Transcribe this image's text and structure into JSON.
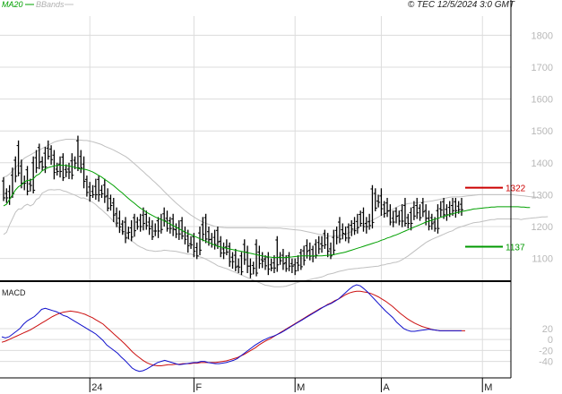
{
  "header": {
    "legend_ma": "MA20",
    "legend_bbands": "BBands",
    "source": "© TEC 12/5/2024 3:0 GMT"
  },
  "colors": {
    "price": "#000000",
    "ma20": "#00a000",
    "bbands": "#c0c0c0",
    "resistance": "#cc0000",
    "support": "#009900",
    "macd": "#1010cc",
    "signal": "#cc1010",
    "grid": "#dcdcdc",
    "axis_text": "#b8b8b8"
  },
  "chart_data": [
    {
      "type": "line",
      "panel": "price",
      "y_ticks": [
        "1800",
        "1700",
        "1600",
        "1500",
        "1400",
        "1300",
        "1200",
        "1100"
      ],
      "y_tick_values": [
        1800,
        1700,
        1600,
        1500,
        1400,
        1300,
        1200,
        1100
      ],
      "ylim": [
        1040,
        1860
      ],
      "x_tick_labels": [
        "24",
        "F",
        "M",
        "A",
        "M"
      ],
      "x_tick_index": [
        29,
        64,
        98,
        127,
        161
      ],
      "levels": [
        {
          "label": "1322",
          "value": 1322,
          "color": "#cc0000"
        },
        {
          "label": "1137",
          "value": 1137,
          "color": "#009900"
        }
      ],
      "series": [
        {
          "name": "MA20",
          "values": [
            1265,
            1270,
            1285,
            1300,
            1315,
            1325,
            1330,
            1340,
            1345,
            1345,
            1350,
            1360,
            1365,
            1375,
            1380,
            1385,
            1388,
            1390,
            1392,
            1393,
            1392,
            1392,
            1390,
            1388,
            1386,
            1383,
            1380,
            1380,
            1378,
            1375,
            1371,
            1366,
            1360,
            1355,
            1348,
            1342,
            1335,
            1328,
            1320,
            1312,
            1305,
            1296,
            1288,
            1280,
            1273,
            1265,
            1258,
            1252,
            1245,
            1240,
            1235,
            1230,
            1226,
            1222,
            1218,
            1213,
            1208,
            1203,
            1198,
            1193,
            1188,
            1183,
            1178,
            1175,
            1170,
            1166,
            1162,
            1158,
            1154,
            1150,
            1146,
            1142,
            1138,
            1136,
            1134,
            1132,
            1130,
            1128,
            1126,
            1124,
            1122,
            1120,
            1118,
            1116,
            1114,
            1112,
            1110,
            1108,
            1106,
            1105,
            1104,
            1103,
            1103,
            1103,
            1103,
            1103,
            1104,
            1105,
            1106,
            1107,
            1108,
            1108,
            1108,
            1108,
            1108,
            1108,
            1108,
            1108,
            1109,
            1110,
            1111,
            1112,
            1114,
            1116,
            1118,
            1120,
            1123,
            1126,
            1129,
            1132,
            1135,
            1138,
            1141,
            1144,
            1147,
            1150,
            1153,
            1157,
            1160,
            1164,
            1167,
            1171,
            1174,
            1178,
            1182,
            1186,
            1190,
            1194,
            1198,
            1202,
            1206,
            1210,
            1214,
            1217,
            1220,
            1223,
            1226,
            1229,
            1232,
            1235,
            1238,
            1240,
            1243,
            1245,
            1247,
            1249,
            1251,
            1253,
            1255,
            1256,
            1257,
            1258,
            1259,
            1260,
            1261,
            1261,
            1262,
            1262,
            1262,
            1262,
            1262,
            1262,
            1262,
            1262,
            1261,
            1261,
            1260,
            1260
          ]
        },
        {
          "name": "BBands upper",
          "values": [
            1355,
            1358,
            1365,
            1375,
            1385,
            1395,
            1405,
            1415,
            1420,
            1425,
            1430,
            1435,
            1440,
            1445,
            1450,
            1455,
            1460,
            1465,
            1468,
            1470,
            1472,
            1474,
            1474,
            1474,
            1473,
            1472,
            1471,
            1470,
            1470,
            1468,
            1466,
            1463,
            1460,
            1457,
            1452,
            1448,
            1444,
            1440,
            1435,
            1430,
            1425,
            1420,
            1413,
            1405,
            1397,
            1389,
            1380,
            1372,
            1363,
            1355,
            1346,
            1338,
            1329,
            1320,
            1310,
            1301,
            1292,
            1283,
            1274,
            1266,
            1258,
            1250,
            1243,
            1236,
            1230,
            1224,
            1219,
            1214,
            1210,
            1207,
            1204,
            1201,
            1199,
            1198,
            1197,
            1196,
            1196,
            1196,
            1196,
            1196,
            1196,
            1196,
            1196,
            1196,
            1196,
            1196,
            1196,
            1196,
            1196,
            1195,
            1195,
            1195,
            1195,
            1195,
            1194,
            1193,
            1192,
            1191,
            1190,
            1189,
            1188,
            1186,
            1184,
            1182,
            1180,
            1178,
            1176,
            1174,
            1172,
            1170,
            1170,
            1170,
            1171,
            1172,
            1174,
            1176,
            1180,
            1185,
            1190,
            1195,
            1200,
            1205,
            1210,
            1215,
            1220,
            1225,
            1230,
            1235,
            1240,
            1245,
            1250,
            1255,
            1260,
            1265,
            1268,
            1270,
            1272,
            1273,
            1274,
            1275,
            1276,
            1277,
            1278,
            1279,
            1280,
            1282,
            1284,
            1286,
            1288,
            1290,
            1292,
            1293,
            1293,
            1293,
            1294,
            1295,
            1296,
            1297,
            1298,
            1299,
            1300,
            1300,
            1300,
            1300,
            1300,
            1300,
            1300,
            1300,
            1300,
            1300,
            1300,
            1300,
            1299,
            1298,
            1297,
            1296,
            1295,
            1294,
            1293,
            1292,
            1290,
            1289
          ]
        },
        {
          "name": "BBands lower",
          "values": [
            1175,
            1182,
            1205,
            1225,
            1245,
            1255,
            1255,
            1265,
            1270,
            1265,
            1270,
            1285,
            1290,
            1305,
            1310,
            1315,
            1316,
            1315,
            1316,
            1316,
            1312,
            1310,
            1306,
            1302,
            1299,
            1294,
            1289,
            1290,
            1286,
            1282,
            1276,
            1269,
            1260,
            1253,
            1244,
            1236,
            1226,
            1216,
            1205,
            1194,
            1185,
            1172,
            1163,
            1155,
            1149,
            1141,
            1136,
            1132,
            1127,
            1125,
            1124,
            1122,
            1123,
            1124,
            1126,
            1125,
            1124,
            1123,
            1122,
            1120,
            1118,
            1116,
            1113,
            1114,
            1110,
            1108,
            1105,
            1102,
            1098,
            1093,
            1088,
            1083,
            1077,
            1074,
            1071,
            1068,
            1064,
            1060,
            1056,
            1052,
            1048,
            1044,
            1040,
            1036,
            1032,
            1028,
            1024,
            1020,
            1016,
            1015,
            1013,
            1011,
            1011,
            1011,
            1012,
            1013,
            1016,
            1019,
            1022,
            1025,
            1028,
            1030,
            1032,
            1034,
            1036,
            1038,
            1040,
            1042,
            1046,
            1050,
            1052,
            1054,
            1057,
            1060,
            1062,
            1064,
            1066,
            1067,
            1068,
            1069,
            1070,
            1071,
            1072,
            1073,
            1074,
            1075,
            1076,
            1079,
            1080,
            1083,
            1084,
            1087,
            1088,
            1091,
            1096,
            1102,
            1108,
            1115,
            1122,
            1129,
            1136,
            1143,
            1150,
            1155,
            1160,
            1164,
            1168,
            1172,
            1176,
            1180,
            1184,
            1187,
            1193,
            1197,
            1200,
            1203,
            1206,
            1209,
            1212,
            1213,
            1214,
            1216,
            1218,
            1220,
            1222,
            1222,
            1224,
            1224,
            1224,
            1224,
            1224,
            1224,
            1224,
            1224,
            1222,
            1224,
            1225,
            1226,
            1227,
            1228,
            1229,
            1230,
            1230,
            1231
          ]
        }
      ],
      "ohlc": {
        "high": [
          1355,
          1320,
          1330,
          1385,
          1420,
          1470,
          1410,
          1360,
          1390,
          1350,
          1420,
          1440,
          1460,
          1420,
          1450,
          1470,
          1455,
          1440,
          1400,
          1420,
          1430,
          1395,
          1400,
          1430,
          1420,
          1485,
          1440,
          1420,
          1360,
          1340,
          1330,
          1350,
          1360,
          1330,
          1350,
          1320,
          1300,
          1290,
          1260,
          1250,
          1220,
          1230,
          1200,
          1220,
          1240,
          1230,
          1240,
          1260,
          1250,
          1230,
          1220,
          1210,
          1230,
          1240,
          1260,
          1250,
          1230,
          1240,
          1210,
          1220,
          1230,
          1200,
          1190,
          1170,
          1180,
          1150,
          1200,
          1230,
          1240,
          1200,
          1180,
          1190,
          1200,
          1170,
          1150,
          1160,
          1150,
          1120,
          1130,
          1100,
          1120,
          1160,
          1140,
          1100,
          1090,
          1160,
          1140,
          1120,
          1110,
          1120,
          1100,
          1110,
          1170,
          1120,
          1130,
          1110,
          1120,
          1100,
          1100,
          1110,
          1130,
          1140,
          1160,
          1150,
          1140,
          1160,
          1170,
          1170,
          1190,
          1180,
          1150,
          1190,
          1200,
          1230,
          1210,
          1200,
          1210,
          1220,
          1230,
          1240,
          1250,
          1260,
          1230,
          1240,
          1330,
          1320,
          1300,
          1320,
          1280,
          1290,
          1270,
          1250,
          1260,
          1250,
          1270,
          1290,
          1240,
          1260,
          1280,
          1290,
          1270,
          1290,
          1270,
          1250,
          1240,
          1230,
          1270,
          1280,
          1290,
          1270,
          1280,
          1290,
          1290,
          1280,
          1290
        ]
      }
    },
    {
      "type": "line",
      "panel": "macd",
      "title": "MACD",
      "y_ticks": [
        "20",
        "0",
        "-20",
        "-40"
      ],
      "y_tick_values": [
        20,
        0,
        -20,
        -40
      ],
      "ylim": [
        -70,
        100
      ],
      "series": [
        {
          "name": "MACD",
          "values": [
            5,
            3,
            5,
            10,
            15,
            20,
            28,
            34,
            38,
            42,
            48,
            55,
            57,
            55,
            53,
            51,
            48,
            44,
            42,
            38,
            34,
            30,
            26,
            22,
            18,
            14,
            10,
            4,
            -2,
            -10,
            -15,
            -20,
            -25,
            -32,
            -38,
            -45,
            -52,
            -56,
            -58,
            -57,
            -54,
            -50,
            -46,
            -42,
            -40,
            -38,
            -40,
            -42,
            -44,
            -46,
            -45,
            -44,
            -43,
            -42,
            -42,
            -40,
            -40,
            -42,
            -43,
            -44,
            -44,
            -43,
            -42,
            -40,
            -38,
            -35,
            -30,
            -25,
            -20,
            -15,
            -10,
            -6,
            -2,
            1,
            4,
            6,
            9,
            12,
            16,
            20,
            24,
            28,
            32,
            36,
            40,
            44,
            48,
            52,
            56,
            60,
            63,
            66,
            70,
            74,
            80,
            86,
            92,
            97,
            100,
            98,
            93,
            87,
            80,
            73,
            66,
            59,
            52,
            46,
            40,
            32,
            26,
            20,
            17,
            15,
            15,
            16,
            17,
            18,
            19,
            18,
            17,
            16,
            16,
            16,
            16,
            16,
            16,
            16
          ]
        },
        {
          "name": "Signal",
          "values": [
            -5,
            -3,
            0,
            3,
            6,
            9,
            12,
            15,
            18,
            22,
            26,
            30,
            34,
            38,
            42,
            45,
            48,
            50,
            51,
            52,
            51,
            50,
            48,
            46,
            43,
            40,
            36,
            32,
            28,
            22,
            16,
            10,
            4,
            -2,
            -8,
            -15,
            -22,
            -28,
            -33,
            -38,
            -42,
            -45,
            -47,
            -48,
            -48,
            -47,
            -46,
            -46,
            -45,
            -45,
            -44,
            -44,
            -44,
            -43,
            -43,
            -42,
            -42,
            -42,
            -42,
            -42,
            -41,
            -40,
            -39,
            -37,
            -35,
            -33,
            -30,
            -27,
            -23,
            -19,
            -15,
            -10,
            -6,
            -2,
            1,
            5,
            9,
            13,
            17,
            21,
            25,
            29,
            33,
            37,
            41,
            45,
            49,
            53,
            57,
            60,
            64,
            67,
            71,
            74,
            78,
            82,
            85,
            87,
            88,
            88,
            87,
            86,
            84,
            81,
            78,
            74,
            70,
            65,
            60,
            54,
            48,
            43,
            38,
            34,
            30,
            27,
            24,
            22,
            20,
            18,
            17,
            16,
            16,
            16,
            16,
            16,
            16,
            16,
            16
          ]
        }
      ]
    }
  ]
}
